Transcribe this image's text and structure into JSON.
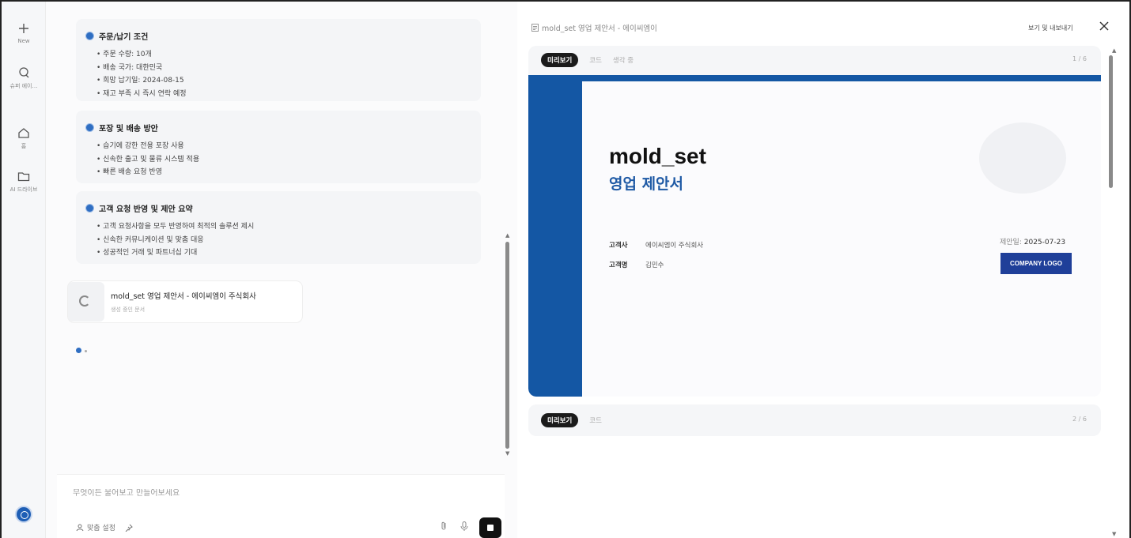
{
  "rail": {
    "new_label": "New",
    "history_label": "슈퍼 에이…",
    "home_label": "홈",
    "drive_label": "AI 드라이브"
  },
  "chat": {
    "sections": [
      {
        "title": "주문/납기 조건",
        "items": [
          "주문 수량: 10개",
          "배송 국가: 대한민국",
          "희망 납기일: 2024-08-15",
          "재고 부족 시 즉시 연락 예정"
        ]
      },
      {
        "title": "포장 및 배송 방안",
        "items": [
          "습기에 강한 전용 포장 사용",
          "신속한 출고 및 물류 시스템 적용",
          "빠른 배송 요청 반영"
        ]
      },
      {
        "title": "고객 요청 반영 및 제안 요약",
        "items": [
          "고객 요청사항을 모두 반영하여 최적의 솔루션 제시",
          "신속한 커뮤니케이션 및 맞춤 대응",
          "성공적인 거래 및 파트너십 기대"
        ]
      }
    ],
    "doc_card": {
      "title": "mold_set 영업 제안서 - 에이씨엠이 주식회사",
      "subtitle": "생성 중인 문서"
    },
    "composer": {
      "placeholder": "무엇이든 물어보고 만들어보세요",
      "personalize_label": "맞춤 설정"
    }
  },
  "preview": {
    "header_title": "mold_set 영업 제안서 - 에이씨엠이",
    "export_label": "보기 및 내보내기",
    "slide1": {
      "tabs": [
        "미리보기",
        "코드",
        "생각 중"
      ],
      "page": "1 / 6",
      "title": "mold_set",
      "subtitle": "영업 제안서",
      "client_label": "고객사",
      "client_value": "에이씨엠이 주식회사",
      "contact_label": "고객명",
      "contact_value": "김민수",
      "date_label": "제안일:",
      "date_value": "2025-07-23",
      "logo_text": "COMPANY LOGO"
    },
    "slide2": {
      "tabs": [
        "미리보기",
        "코드"
      ],
      "page": "2 / 6"
    }
  },
  "colors": {
    "accent": "#1457a4",
    "logo_bg": "#1f3f99",
    "subtitle": "#1f5aa5"
  }
}
